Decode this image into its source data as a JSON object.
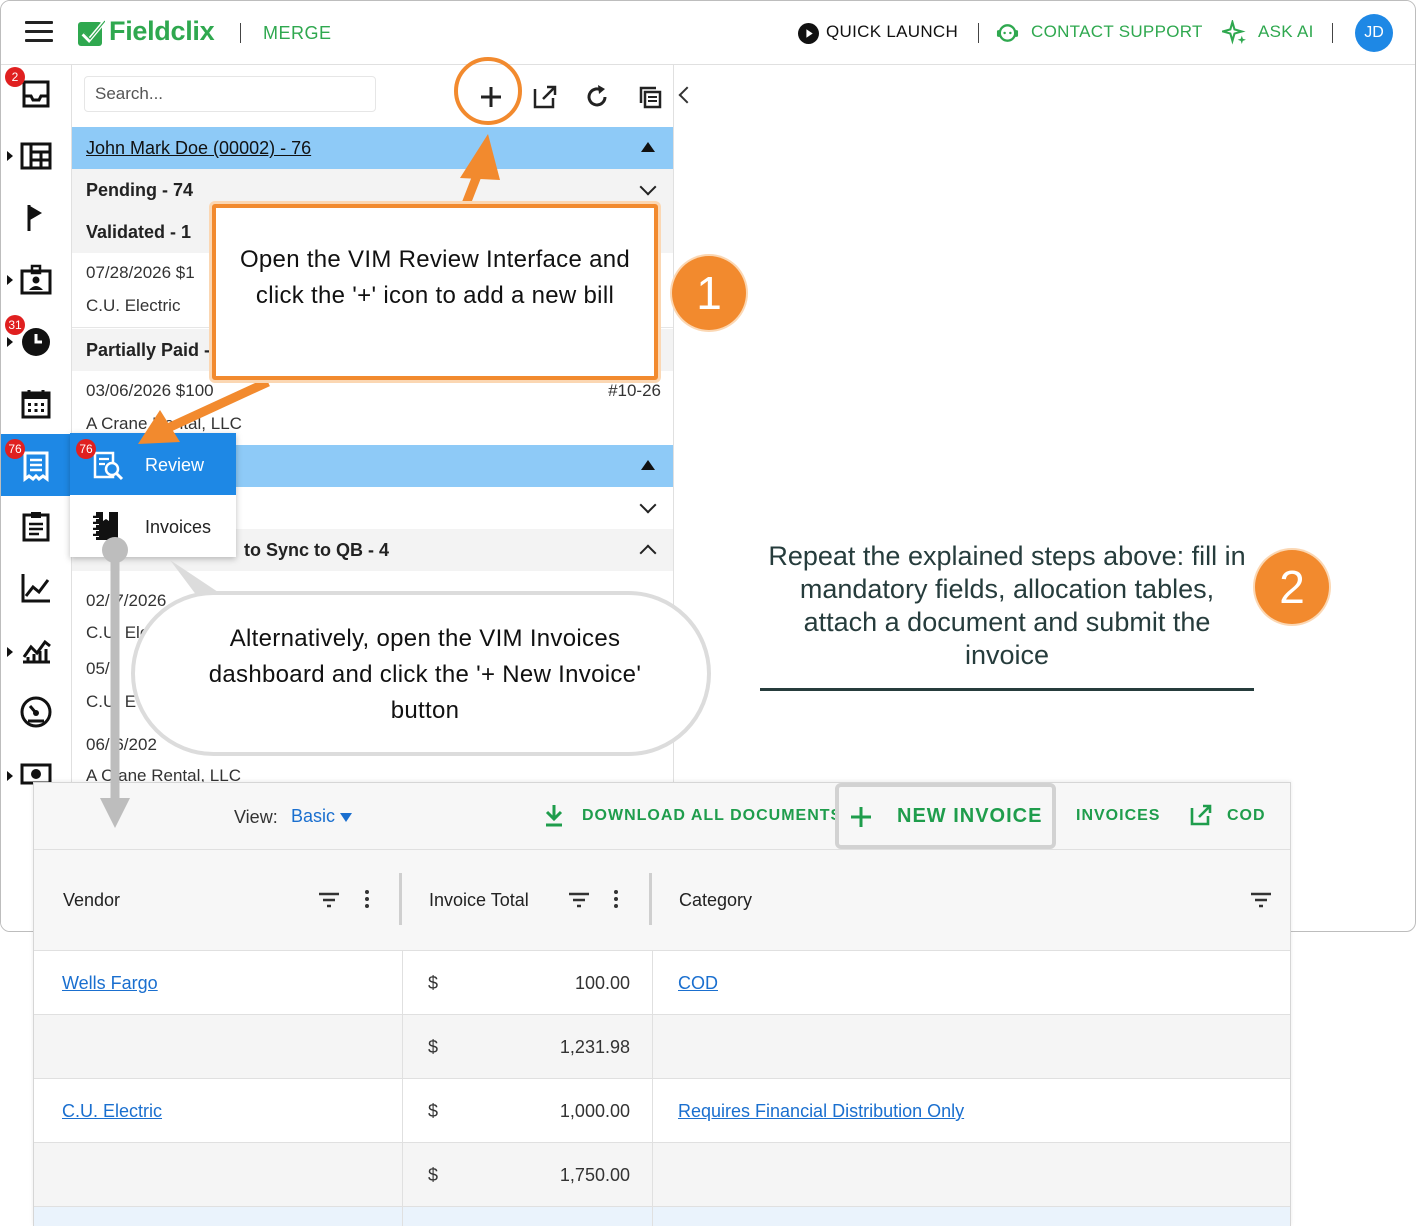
{
  "topbar": {
    "brand": "Fieldclix",
    "module": "MERGE",
    "quick_launch": "QUICK LAUNCH",
    "contact_support": "CONTACT SUPPORT",
    "ask_ai": "ASK AI",
    "user_initials": "JD"
  },
  "nav": {
    "badges": {
      "inbox": "2",
      "time": "31",
      "vim": "76"
    }
  },
  "panel": {
    "search_placeholder": "Search...",
    "group1": "John Mark Doe (00002) - 76",
    "pending": "Pending - 74",
    "validated": "Validated - 1",
    "row1": {
      "date_amount": "07/28/2026   $1",
      "vendor": "C.U. Electric"
    },
    "partially_paid": "Partially Paid -",
    "row2": {
      "date_amount": "03/06/2026   $100",
      "number": "#10-26",
      "vendor": "A Crane Rental, LLC"
    },
    "sync_qb": "to Sync to QB - 4",
    "row3": {
      "date": "02/  7/2026",
      "vendor": "C.U. Ele"
    },
    "row4": {
      "date": "05/",
      "vendor": "C.U. E"
    },
    "row5": {
      "date": "06/  6/202",
      "vendor": "A C  ane Rental, LLC"
    }
  },
  "popup_menu": {
    "review_badge": "76",
    "review": "Review",
    "invoices": "Invoices"
  },
  "callouts": {
    "step1_text": "Open the VIM Review Interface and click the '+' icon to add a new bill",
    "step1_number": "1",
    "alt_text": "Alternatively, open the VIM Invoices dashboard and click the '+ New Invoice' button",
    "step2_text": "Repeat the explained steps above: fill in mandatory fields, allocation tables, attach a document and submit the invoice",
    "step2_number": "2"
  },
  "dashboard": {
    "view_label": "View:",
    "view_value": "Basic",
    "download_all": "DOWNLOAD ALL DOCUMENTS",
    "new_invoice": "NEW INVOICE",
    "invoices": "INVOICES",
    "cod": "COD",
    "columns": [
      "Vendor",
      "Invoice Total",
      "Category"
    ],
    "rows": [
      {
        "vendor": "Wells Fargo",
        "currency": "$",
        "total": "100.00",
        "category": "COD"
      },
      {
        "vendor": "",
        "currency": "$",
        "total": "1,231.98",
        "category": ""
      },
      {
        "vendor": "C.U. Electric",
        "currency": "$",
        "total": "1,000.00",
        "category": "Requires Financial Distribution Only"
      },
      {
        "vendor": "",
        "currency": "$",
        "total": "1,750.00",
        "category": ""
      }
    ]
  },
  "colors": {
    "brand_green": "#2fa84f",
    "accent_blue": "#1e88e5",
    "callout_orange": "#f28a2e",
    "group_header_blue": "#8ecaf7",
    "link_blue": "#1a6fcf"
  }
}
